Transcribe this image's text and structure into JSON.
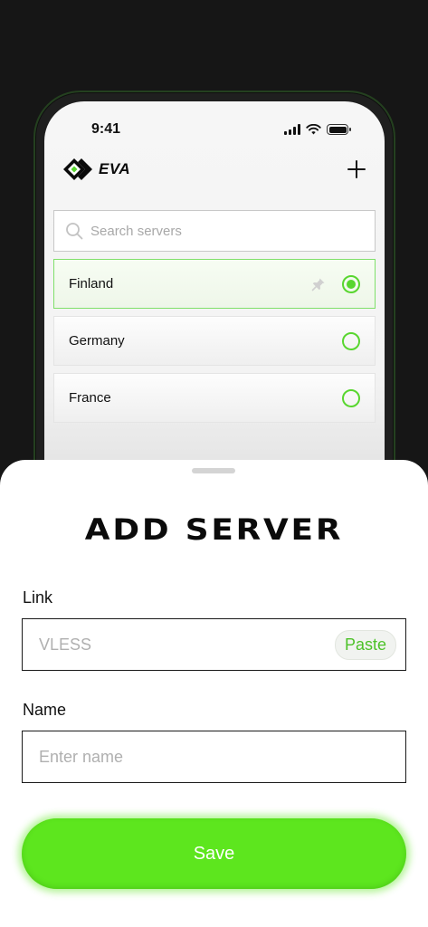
{
  "status_bar": {
    "time": "9:41"
  },
  "app": {
    "logo_text": "EVA"
  },
  "search": {
    "placeholder": "Search servers"
  },
  "servers": [
    {
      "name": "Finland",
      "selected": true,
      "pinned": true
    },
    {
      "name": "Germany",
      "selected": false,
      "pinned": false
    },
    {
      "name": "France",
      "selected": false,
      "pinned": false
    }
  ],
  "sheet": {
    "title": "ADD SERVER",
    "link_label": "Link",
    "link_placeholder": "VLESS",
    "paste_label": "Paste",
    "name_label": "Name",
    "name_placeholder": "Enter name",
    "save_label": "Save"
  },
  "colors": {
    "accent": "#5de61e",
    "radio": "#58d62f",
    "background": "#161616"
  }
}
